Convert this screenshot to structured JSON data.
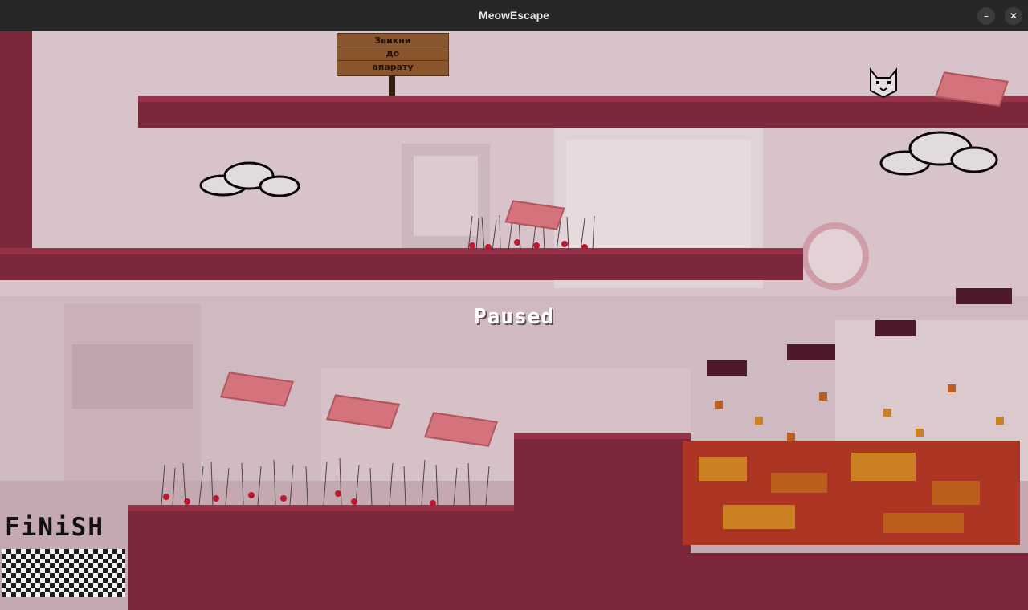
{
  "window": {
    "title": "MeowEscape",
    "minimize_label": "–",
    "close_label": "✕"
  },
  "game": {
    "status_text": "Paused",
    "sign_lines": [
      "Звикни",
      "до",
      "апарату"
    ],
    "finish_label": "FiNiSH"
  },
  "colors": {
    "platform": "#7d2638",
    "lava": "#c1441a",
    "background_tint": "#cdbfc3"
  }
}
